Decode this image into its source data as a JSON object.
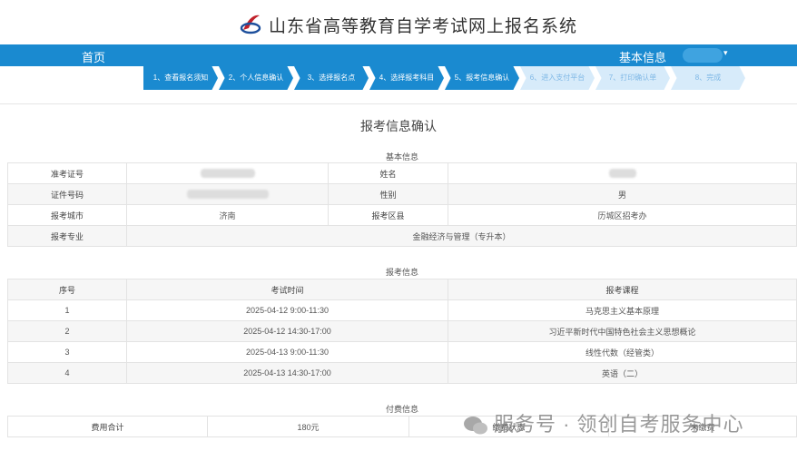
{
  "header": {
    "site_title": "山东省高等教育自学考试网上报名系统"
  },
  "nav": {
    "home": "首页",
    "basic": "基本信息",
    "caret": "▾"
  },
  "steps": [
    "1、查看报名须知",
    "2、个人信息确认",
    "3、选择报名点",
    "4、选择报考科目",
    "5、报考信息确认",
    "6、进入支付平台",
    "7、打印确认单",
    "8、完成"
  ],
  "current_step": 5,
  "page_title": "报考信息确认",
  "basic": {
    "section": "基本信息",
    "admit_label": "准考证号",
    "name_label": "姓名",
    "id_label": "证件号码",
    "gender_label": "性别",
    "gender": "男",
    "city_label": "报考城市",
    "city": "济南",
    "district_label": "报考区县",
    "district": "历城区招考办",
    "major_label": "报考专业",
    "major": "金融经济与管理（专升本）"
  },
  "exam": {
    "section": "报考信息",
    "headers": [
      "序号",
      "考试时间",
      "报考课程"
    ],
    "rows": [
      [
        "1",
        "2025-04-12 9:00-11:30",
        "马克思主义基本原理"
      ],
      [
        "2",
        "2025-04-12 14:30-17:00",
        "习近平新时代中国特色社会主义思想概论"
      ],
      [
        "3",
        "2025-04-13 9:00-11:30",
        "线性代数（经管类）"
      ],
      [
        "4",
        "2025-04-13 14:30-17:00",
        "英语（二）"
      ]
    ]
  },
  "payment": {
    "section": "付费信息",
    "total_label": "费用合计",
    "total": "180元",
    "status_label": "缴费状态",
    "status": "未缴费"
  },
  "watermark": "服务号 · 领创自考服务中心",
  "colors": {
    "primary": "#1a8ad0",
    "step_todo": "#d7ebfa"
  }
}
